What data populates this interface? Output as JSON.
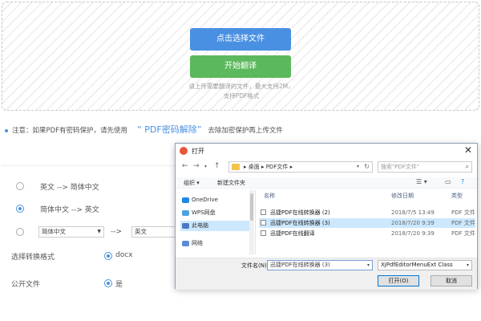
{
  "upload": {
    "select_button": "点击选择文件",
    "translate_button": "开始翻译",
    "hint_line1": "请上传需要翻译的文件，最大支持2M，",
    "hint_line2": "支持PDF格式"
  },
  "notice": {
    "text": "注意：如果PDF有密码保护，请先使用",
    "link": "“ PDF密码解除”",
    "suffix": "去除加密保护再上传文件"
  },
  "options": {
    "direction1": "英文 --> 简体中文",
    "direction2": "简体中文 --> 英文",
    "from_lang": "简体中文",
    "arrow": "-->",
    "to_lang": "英文",
    "format_label": "选择转换格式",
    "format_value": "docx",
    "public_label": "公开文件",
    "public_value": "是"
  },
  "dialog": {
    "title": "打开",
    "close": "✕",
    "breadcrumb": "▸  桌面  ▸  PDF文件  ▸",
    "search_placeholder": "搜索\"PDF文件\"",
    "toolbar_organize": "组织 ▾",
    "toolbar_newfolder": "新建文件夹",
    "sidebar": [
      {
        "label": "OneDrive",
        "color": "#1e88e5"
      },
      {
        "label": "WPS网盘",
        "color": "#4fa3e0"
      },
      {
        "label": "此电脑",
        "color": "#4a78c2"
      },
      {
        "label": "网络",
        "color": "#5b8dd6"
      }
    ],
    "columns": {
      "name": "名称",
      "date": "修改日期",
      "type": "类型"
    },
    "files": [
      {
        "name": "迅捷PDF在线转换器 (2)",
        "date": "2018/7/5 13:49",
        "type": "PDF 文件"
      },
      {
        "name": "迅捷PDF在线转换器 (3)",
        "date": "2018/7/20 9:39",
        "type": "PDF 文件"
      },
      {
        "name": "迅捷PDF在线翻译",
        "date": "2018/7/20 9:39",
        "type": "PDF 文件"
      }
    ],
    "filename_label": "文件名(N):",
    "filename_value": "迅捷PDF在线转换器 (3)",
    "filter_value": "XjPdfEditorMenuExt Class",
    "open_button": "打开(O)",
    "cancel_button": "取消"
  }
}
